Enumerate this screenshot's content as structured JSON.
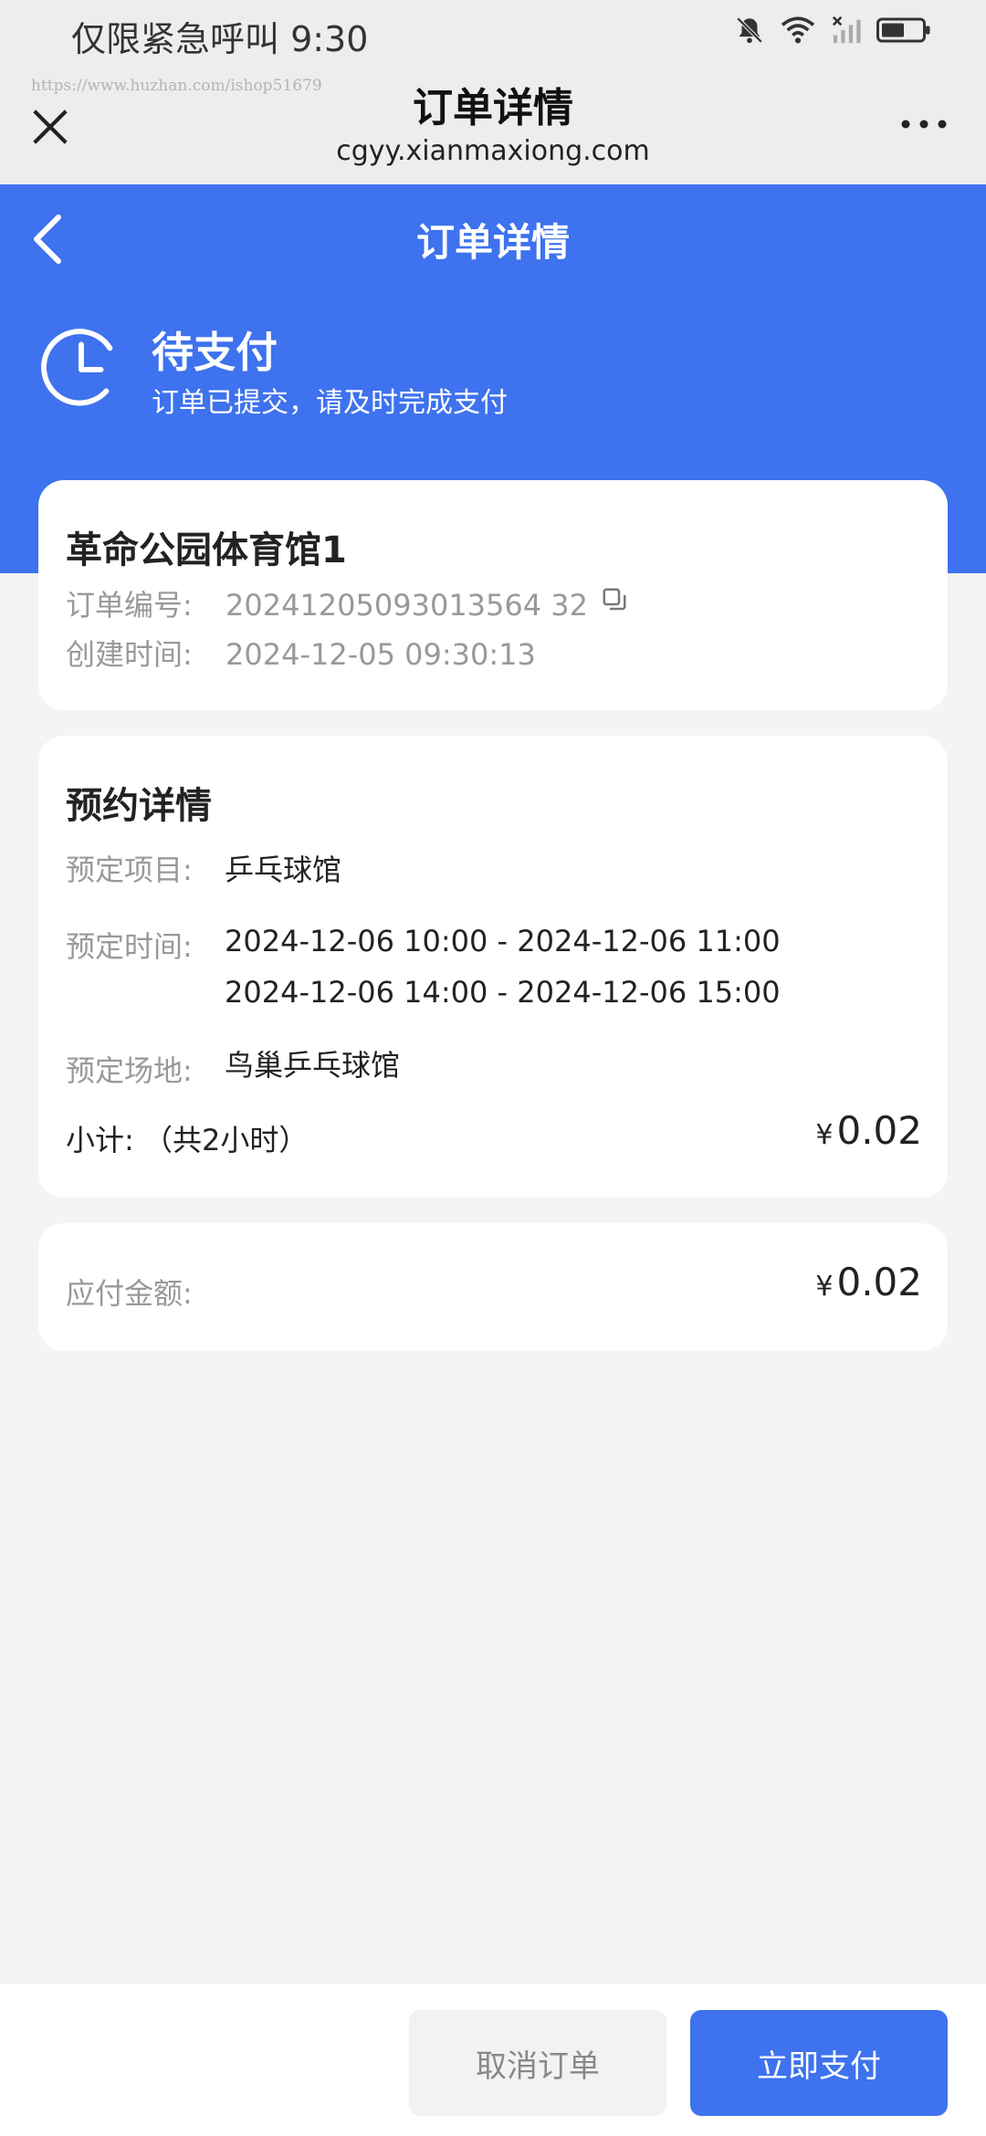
{
  "status_bar": {
    "carrier_time": "仅限紧急呼叫 9:30",
    "icons": [
      "bell-off-icon",
      "wifi-icon",
      "signal-icon",
      "battery-icon"
    ]
  },
  "browser": {
    "watermark": "https://www.huzhan.com/ishop51679",
    "title": "订单详情",
    "url": "cgyy.xianmaxiong.com"
  },
  "header": {
    "title": "订单详情",
    "status_title": "待支付",
    "status_subtitle": "订单已提交，请及时完成支付"
  },
  "order": {
    "venue_name": "革命公园体育馆1",
    "number_label": "订单编号:",
    "number": "20241205093013564 32",
    "created_label": "创建时间:",
    "created": "2024-12-05 09:30:13"
  },
  "booking": {
    "section_title": "预约详情",
    "item_label": "预定项目:",
    "item": "乒乓球馆",
    "time_label": "预定时间:",
    "times": [
      "2024-12-06 10:00 - 2024-12-06 11:00",
      "2024-12-06 14:00 - 2024-12-06 15:00"
    ],
    "venue_label": "预定场地:",
    "venue": "鸟巢乒乓球馆",
    "subtotal_label": "小计: （共2小时）",
    "currency": "¥",
    "subtotal": "0.02"
  },
  "total": {
    "label": "应付金额:",
    "currency": "¥",
    "amount": "0.02"
  },
  "actions": {
    "cancel_label": "取消订单",
    "pay_label": "立即支付"
  },
  "colors": {
    "primary": "#3e72ee",
    "page_bg": "#f4f4f4",
    "muted_text": "#999999"
  }
}
